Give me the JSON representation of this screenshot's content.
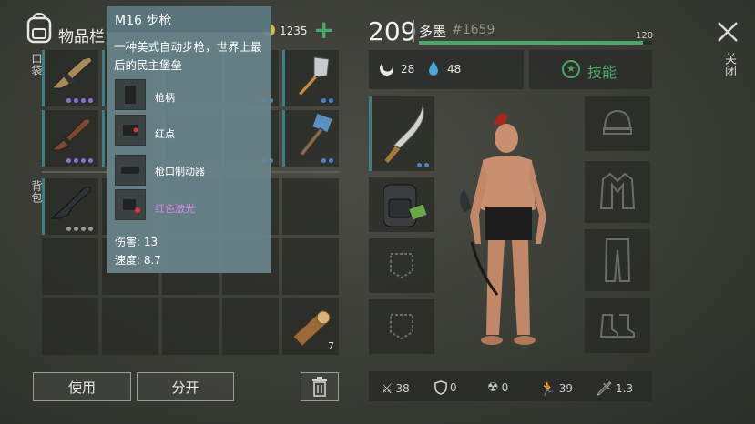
{
  "header": {
    "title": "物品栏",
    "coins": "1235",
    "add_label": "+"
  },
  "side_labels": {
    "pocket": "口袋",
    "backpack": "背包"
  },
  "tooltip": {
    "title": "M16 步枪",
    "description": "一种美式自动步枪，世界上最后的民主堡垒",
    "attachments": [
      {
        "label": "枪柄",
        "icon": "grip-icon"
      },
      {
        "label": "红点",
        "icon": "red-dot-sight-icon"
      },
      {
        "label": "枪口制动器",
        "icon": "muzzle-brake-icon"
      },
      {
        "label": "红色激光",
        "icon": "red-laser-icon"
      }
    ],
    "damage": "伤害: 13",
    "speed": "速度: 8.7"
  },
  "inventory": {
    "log_count": "7"
  },
  "actions": {
    "use_label": "使用",
    "split_label": "分开"
  },
  "player": {
    "level": "209",
    "name": "多墨",
    "id": "#1659",
    "xp_max": "120",
    "xp_fraction": 0.96,
    "hunger": "28",
    "thirst": "48",
    "skills_label": "技能"
  },
  "close_label": "关闭",
  "stats": {
    "attack": "38",
    "defense": "0",
    "radiation": "0",
    "speed": "39",
    "stealth": "1.3"
  },
  "colors": {
    "accent": "#4aa86a",
    "slot_bar": "#3e7f86",
    "tooltip_bg": "#68848a",
    "laser_text": "#d488e8",
    "dot_purple": "#8a6fd8",
    "dot_blue": "#4a84c8",
    "dot_gray": "#9a9a9a"
  }
}
